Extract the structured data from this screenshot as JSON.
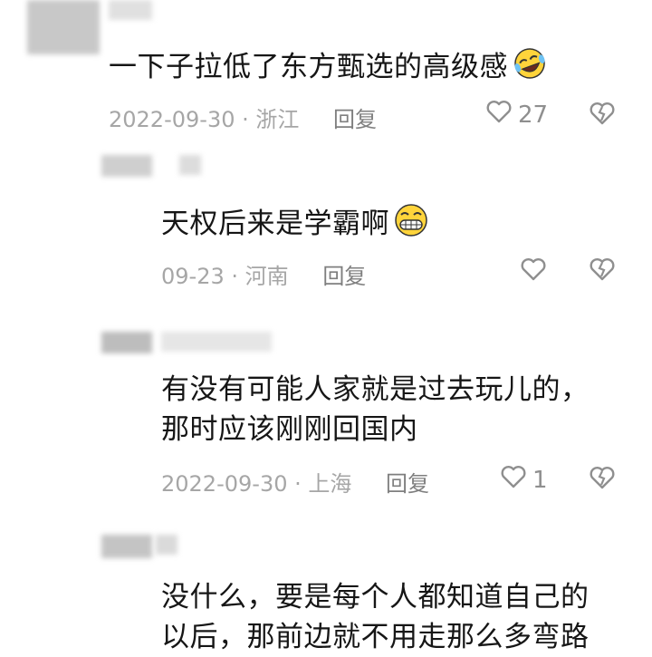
{
  "comments": [
    {
      "text": "一下子拉低了东方甄选的高级感",
      "emoji": "laughing-tears-emoji",
      "date": "2022-09-30",
      "location": "浙江",
      "reply_label": "回复",
      "likes": "27"
    },
    {
      "text": "天权后来是学霸啊",
      "emoji": "grinning-emoji",
      "date": "09-23",
      "location": "河南",
      "reply_label": "回复",
      "likes": ""
    },
    {
      "text_line1": "有没有可能人家就是过去玩儿的，",
      "text_line2": "那时应该刚刚回国内",
      "date": "2022-09-30",
      "location": "上海",
      "reply_label": "回复",
      "likes": "1"
    },
    {
      "text_line1": "没什么，要是每个人都知道自己的",
      "text_line2": "以后，那前边就不用走那么多弯路"
    }
  ],
  "separator": "·",
  "colors": {
    "text": "#161616",
    "meta": "#a6a6a6",
    "icon": "#8f8f8f"
  }
}
